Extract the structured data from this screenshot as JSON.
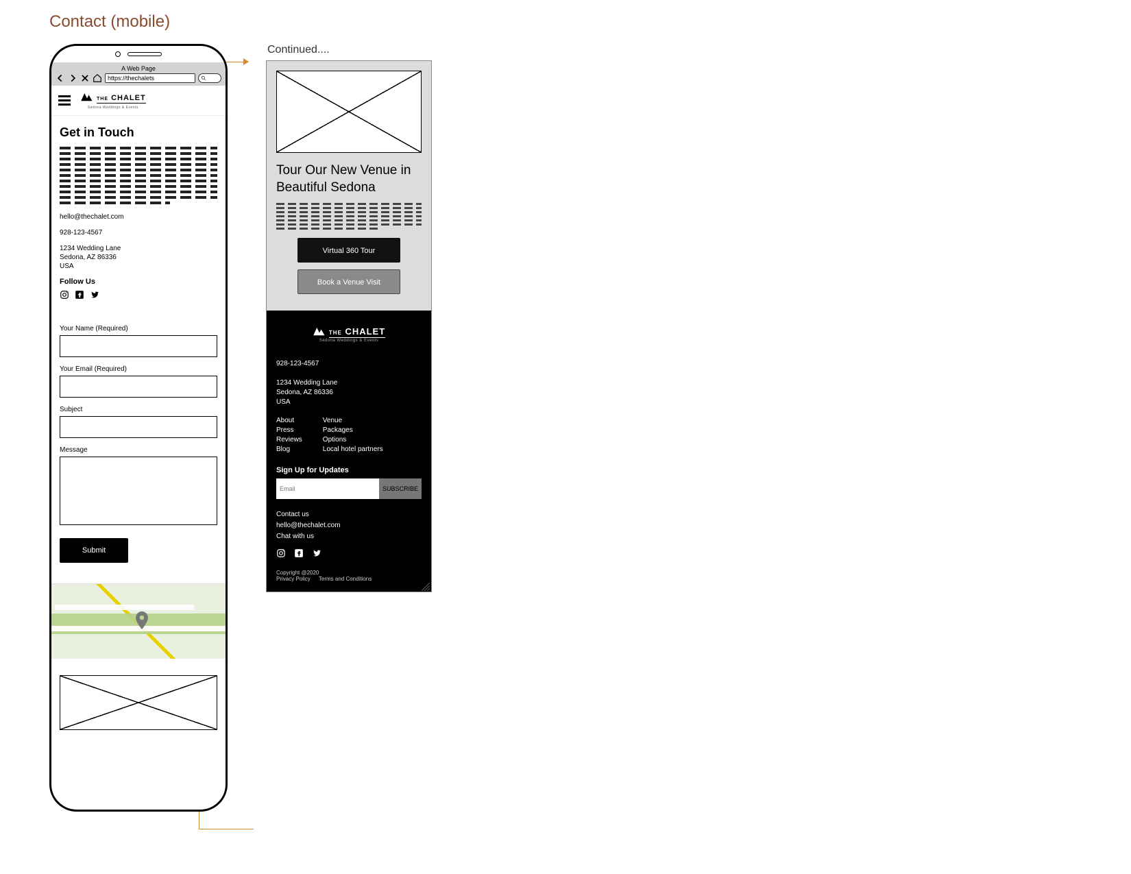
{
  "page_title": "Contact (mobile)",
  "continued_label": "Continued....",
  "browser": {
    "title": "A Web Page",
    "url": "https://thechalets"
  },
  "brand": {
    "name_line1": "THE",
    "name_line2": "CHALET",
    "tagline": "Sedona Weddings & Events"
  },
  "contact_section": {
    "heading": "Get in Touch",
    "email": "hello@thechalet.com",
    "phone": "928-123-4567",
    "address_line1": "1234 Wedding Lane",
    "address_line2": "Sedona, AZ 86336",
    "address_line3": "USA",
    "follow_heading": "Follow Us"
  },
  "form": {
    "name_label": "Your Name (Required)",
    "email_label": "Your Email (Required)",
    "subject_label": "Subject",
    "message_label": "Message",
    "submit_label": "Submit"
  },
  "venue": {
    "heading": "Tour Our New Venue in Beautiful Sedona",
    "virtual_btn": "Virtual 360 Tour",
    "book_btn": "Book a Venue Visit"
  },
  "footer": {
    "phone": "928-123-4567",
    "address_line1": "1234 Wedding Lane",
    "address_line2": "Sedona, AZ 86336",
    "address_line3": "USA",
    "col1": [
      "About",
      "Press",
      "Reviews",
      "Blog"
    ],
    "col2": [
      "Venue",
      "Packages",
      "Options",
      "Local hotel partners"
    ],
    "signup_heading": "Sign Up for Updates",
    "email_placeholder": "Email",
    "subscribe_label": "SUBSCRIBE",
    "contact_us": "Contact us",
    "contact_email": "hello@thechalet.com",
    "chat": "Chat with us",
    "copyright": "Copyright @2020",
    "privacy": "Privacy Policy",
    "terms": "Terms and Conditions"
  }
}
